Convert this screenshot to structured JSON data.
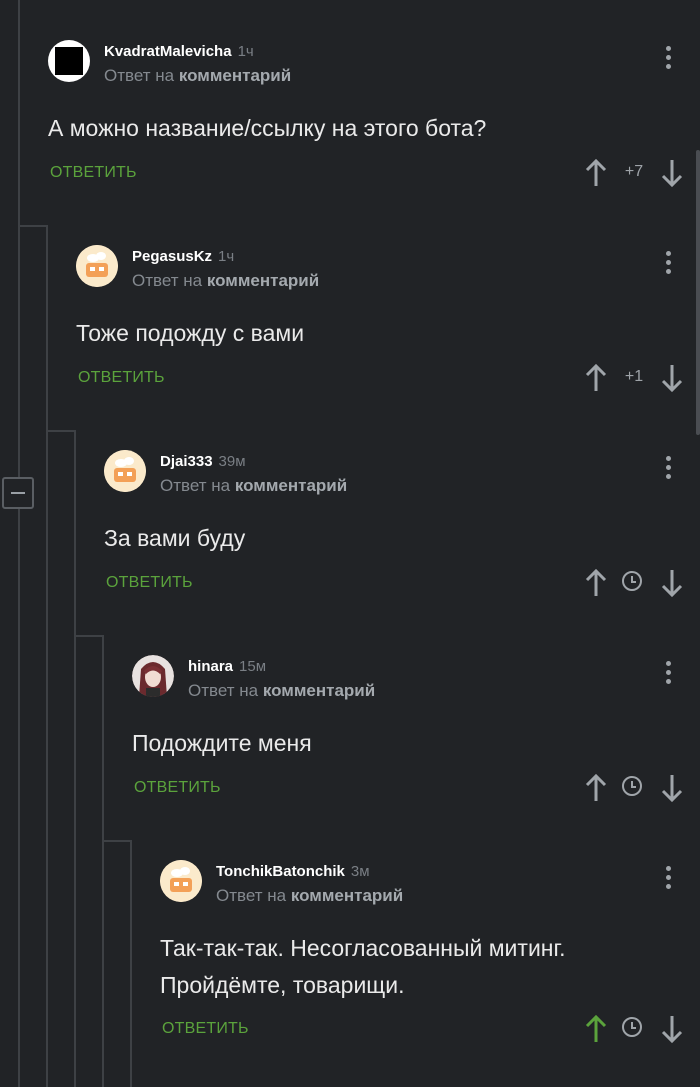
{
  "comments": [
    {
      "username": "KvadratMalevicha",
      "time": "1ч",
      "reply_prefix": "Ответ на",
      "reply_target": "комментарий",
      "text_lines": [
        "А можно название/ссылку на этого бота?"
      ],
      "reply_label": "ОТВЕТИТЬ",
      "score": "+7",
      "avatar": "black-square-avatar"
    },
    {
      "username": "PegasusKz",
      "time": "1ч",
      "reply_prefix": "Ответ на",
      "reply_target": "комментарий",
      "text_lines": [
        "Тоже подожду с вами"
      ],
      "reply_label": "ОТВЕТИТЬ",
      "score": "+1",
      "avatar": "pikabu-default-avatar"
    },
    {
      "username": "Djai333",
      "time": "39м",
      "reply_prefix": "Ответ на",
      "reply_target": "комментарий",
      "text_lines": [
        "За вами буду"
      ],
      "reply_label": "ОТВЕТИТЬ",
      "score_icon": "clock-icon",
      "avatar": "pikabu-default-avatar"
    },
    {
      "username": "hinara",
      "time": "15м",
      "reply_prefix": "Ответ на",
      "reply_target": "комментарий",
      "text_lines": [
        "Подождите меня"
      ],
      "reply_label": "ОТВЕТИТЬ",
      "score_icon": "clock-icon",
      "avatar": "anime-girl-avatar"
    },
    {
      "username": "TonchikBatonchik",
      "time": "3м",
      "reply_prefix": "Ответ на",
      "reply_target": "комментарий",
      "text_lines": [
        "Так-так-так. Несогласованный митинг.",
        "Пройдёмте, товарищи."
      ],
      "reply_label": "ОТВЕТИТЬ",
      "score_icon": "clock-icon",
      "upvoted": true,
      "avatar": "pikabu-default-avatar"
    }
  ],
  "colors": {
    "background": "#212326",
    "reply_green": "#5ba33c",
    "upvote_active": "#5ba33c",
    "thread_line": "#3e4145"
  }
}
